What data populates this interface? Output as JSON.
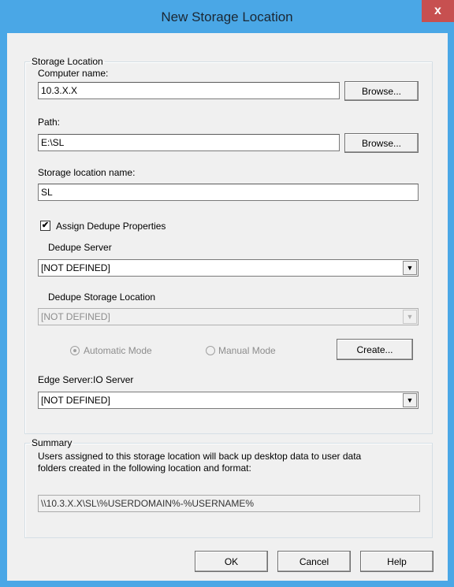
{
  "window": {
    "title": "New Storage Location",
    "close_glyph": "x"
  },
  "storage_group": {
    "legend": "Storage Location",
    "computer_name_label": "Computer name:",
    "computer_name_value": "10.3.X.X",
    "browse_label": "Browse...",
    "path_label": "Path:",
    "path_value": "E:\\SL",
    "storage_name_label": "Storage location name:",
    "storage_name_value": "SL",
    "assign_dedupe_label": "Assign Dedupe Properties",
    "assign_dedupe_checked": true,
    "dedupe_server_label": "Dedupe Server",
    "dedupe_server_value": "[NOT DEFINED]",
    "dedupe_storage_label": "Dedupe Storage Location",
    "dedupe_storage_value": "[NOT DEFINED]",
    "automatic_mode_label": "Automatic Mode",
    "manual_mode_label": "Manual Mode",
    "create_label": "Create...",
    "edge_server_label": "Edge Server:IO Server",
    "edge_server_value": "[NOT DEFINED]"
  },
  "summary_group": {
    "legend": "Summary",
    "text_line1": "Users assigned to this storage location will back up desktop data to user data",
    "text_line2": "folders created in the following location and format:",
    "path_value": "\\\\10.3.X.X\\SL\\%USERDOMAIN%-%USERNAME%"
  },
  "footer": {
    "ok_label": "OK",
    "cancel_label": "Cancel",
    "help_label": "Help"
  },
  "icons": {
    "checkmark": "✔",
    "dropdown": "▼"
  }
}
